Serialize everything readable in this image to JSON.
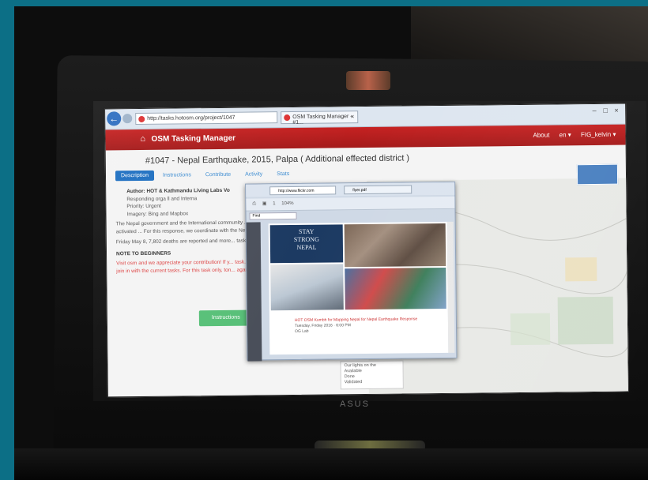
{
  "browser": {
    "address": "http://tasks.hotosm.org/project/1047",
    "tab_title": "OSM Tasking Manager - #1...",
    "tab_close": "×",
    "window_buttons": [
      "–",
      "□",
      "×"
    ]
  },
  "header": {
    "brand": "OSM Tasking Manager",
    "nav": [
      "About",
      "en ▾",
      "FIG_kelvin ▾"
    ]
  },
  "project": {
    "title": "#1047 - Nepal Earthquake, 2015, Palpa ( Additional effected district )",
    "tabs": [
      "Description",
      "Instructions",
      "Contribute",
      "Activity",
      "Stats"
    ],
    "bullets": [
      "Author: HOT & Kathmandu Living Labs Vo",
      "Responding orga         ll and Interna",
      "Priority: Urgent",
      "Imagery: Bing and Mapbox"
    ],
    "para1": "The Nepal government and the International community ... emergency. The international charter was activated ... For this response, we coordinate with the Nepal g... organizations and the Crowdwork.",
    "para2": "Friday May 8, 7,802 deaths are reported and more... task we will map details such as roads, building...",
    "note_heading": "NOTE TO BEGINNERS",
    "note_text": "Visit osm and we appreciate your contribution! If y... task. We need to contour more data, from the b... join in with the current tasks. For this task only, ton... against the HOTosmtask workflow.",
    "start_button": "Instructions"
  },
  "legend": [
    "Our lights on the",
    "Available",
    "Done",
    "Validated"
  ],
  "popup": {
    "address": "http://www.flickr.com",
    "tab": "flyer.pdf",
    "page": "1",
    "zoom": "104%",
    "find": "Find",
    "poster_text": [
      "STAY",
      "STRONG",
      "NEPAL"
    ],
    "caption": "HOT OSM Kumbh for Mapping Nepal for Nepal Earthquake Response",
    "caption_date": "Tuesday, Friday 2016 · 6:00 PM",
    "caption_place": "OG Lab"
  },
  "laptop_brand": "ASUS"
}
